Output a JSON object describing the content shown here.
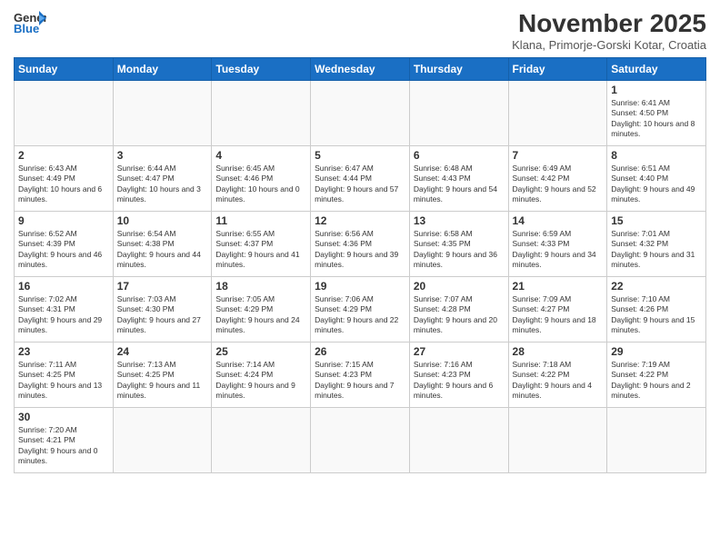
{
  "header": {
    "logo_general": "General",
    "logo_blue": "Blue",
    "month_title": "November 2025",
    "location": "Klana, Primorje-Gorski Kotar, Croatia"
  },
  "weekdays": [
    "Sunday",
    "Monday",
    "Tuesday",
    "Wednesday",
    "Thursday",
    "Friday",
    "Saturday"
  ],
  "weeks": [
    [
      {
        "day": "",
        "info": ""
      },
      {
        "day": "",
        "info": ""
      },
      {
        "day": "",
        "info": ""
      },
      {
        "day": "",
        "info": ""
      },
      {
        "day": "",
        "info": ""
      },
      {
        "day": "",
        "info": ""
      },
      {
        "day": "1",
        "info": "Sunrise: 6:41 AM\nSunset: 4:50 PM\nDaylight: 10 hours and 8 minutes."
      }
    ],
    [
      {
        "day": "2",
        "info": "Sunrise: 6:43 AM\nSunset: 4:49 PM\nDaylight: 10 hours and 6 minutes."
      },
      {
        "day": "3",
        "info": "Sunrise: 6:44 AM\nSunset: 4:47 PM\nDaylight: 10 hours and 3 minutes."
      },
      {
        "day": "4",
        "info": "Sunrise: 6:45 AM\nSunset: 4:46 PM\nDaylight: 10 hours and 0 minutes."
      },
      {
        "day": "5",
        "info": "Sunrise: 6:47 AM\nSunset: 4:44 PM\nDaylight: 9 hours and 57 minutes."
      },
      {
        "day": "6",
        "info": "Sunrise: 6:48 AM\nSunset: 4:43 PM\nDaylight: 9 hours and 54 minutes."
      },
      {
        "day": "7",
        "info": "Sunrise: 6:49 AM\nSunset: 4:42 PM\nDaylight: 9 hours and 52 minutes."
      },
      {
        "day": "8",
        "info": "Sunrise: 6:51 AM\nSunset: 4:40 PM\nDaylight: 9 hours and 49 minutes."
      }
    ],
    [
      {
        "day": "9",
        "info": "Sunrise: 6:52 AM\nSunset: 4:39 PM\nDaylight: 9 hours and 46 minutes."
      },
      {
        "day": "10",
        "info": "Sunrise: 6:54 AM\nSunset: 4:38 PM\nDaylight: 9 hours and 44 minutes."
      },
      {
        "day": "11",
        "info": "Sunrise: 6:55 AM\nSunset: 4:37 PM\nDaylight: 9 hours and 41 minutes."
      },
      {
        "day": "12",
        "info": "Sunrise: 6:56 AM\nSunset: 4:36 PM\nDaylight: 9 hours and 39 minutes."
      },
      {
        "day": "13",
        "info": "Sunrise: 6:58 AM\nSunset: 4:35 PM\nDaylight: 9 hours and 36 minutes."
      },
      {
        "day": "14",
        "info": "Sunrise: 6:59 AM\nSunset: 4:33 PM\nDaylight: 9 hours and 34 minutes."
      },
      {
        "day": "15",
        "info": "Sunrise: 7:01 AM\nSunset: 4:32 PM\nDaylight: 9 hours and 31 minutes."
      }
    ],
    [
      {
        "day": "16",
        "info": "Sunrise: 7:02 AM\nSunset: 4:31 PM\nDaylight: 9 hours and 29 minutes."
      },
      {
        "day": "17",
        "info": "Sunrise: 7:03 AM\nSunset: 4:30 PM\nDaylight: 9 hours and 27 minutes."
      },
      {
        "day": "18",
        "info": "Sunrise: 7:05 AM\nSunset: 4:29 PM\nDaylight: 9 hours and 24 minutes."
      },
      {
        "day": "19",
        "info": "Sunrise: 7:06 AM\nSunset: 4:29 PM\nDaylight: 9 hours and 22 minutes."
      },
      {
        "day": "20",
        "info": "Sunrise: 7:07 AM\nSunset: 4:28 PM\nDaylight: 9 hours and 20 minutes."
      },
      {
        "day": "21",
        "info": "Sunrise: 7:09 AM\nSunset: 4:27 PM\nDaylight: 9 hours and 18 minutes."
      },
      {
        "day": "22",
        "info": "Sunrise: 7:10 AM\nSunset: 4:26 PM\nDaylight: 9 hours and 15 minutes."
      }
    ],
    [
      {
        "day": "23",
        "info": "Sunrise: 7:11 AM\nSunset: 4:25 PM\nDaylight: 9 hours and 13 minutes."
      },
      {
        "day": "24",
        "info": "Sunrise: 7:13 AM\nSunset: 4:25 PM\nDaylight: 9 hours and 11 minutes."
      },
      {
        "day": "25",
        "info": "Sunrise: 7:14 AM\nSunset: 4:24 PM\nDaylight: 9 hours and 9 minutes."
      },
      {
        "day": "26",
        "info": "Sunrise: 7:15 AM\nSunset: 4:23 PM\nDaylight: 9 hours and 7 minutes."
      },
      {
        "day": "27",
        "info": "Sunrise: 7:16 AM\nSunset: 4:23 PM\nDaylight: 9 hours and 6 minutes."
      },
      {
        "day": "28",
        "info": "Sunrise: 7:18 AM\nSunset: 4:22 PM\nDaylight: 9 hours and 4 minutes."
      },
      {
        "day": "29",
        "info": "Sunrise: 7:19 AM\nSunset: 4:22 PM\nDaylight: 9 hours and 2 minutes."
      }
    ],
    [
      {
        "day": "30",
        "info": "Sunrise: 7:20 AM\nSunset: 4:21 PM\nDaylight: 9 hours and 0 minutes."
      },
      {
        "day": "",
        "info": ""
      },
      {
        "day": "",
        "info": ""
      },
      {
        "day": "",
        "info": ""
      },
      {
        "day": "",
        "info": ""
      },
      {
        "day": "",
        "info": ""
      },
      {
        "day": "",
        "info": ""
      }
    ]
  ]
}
